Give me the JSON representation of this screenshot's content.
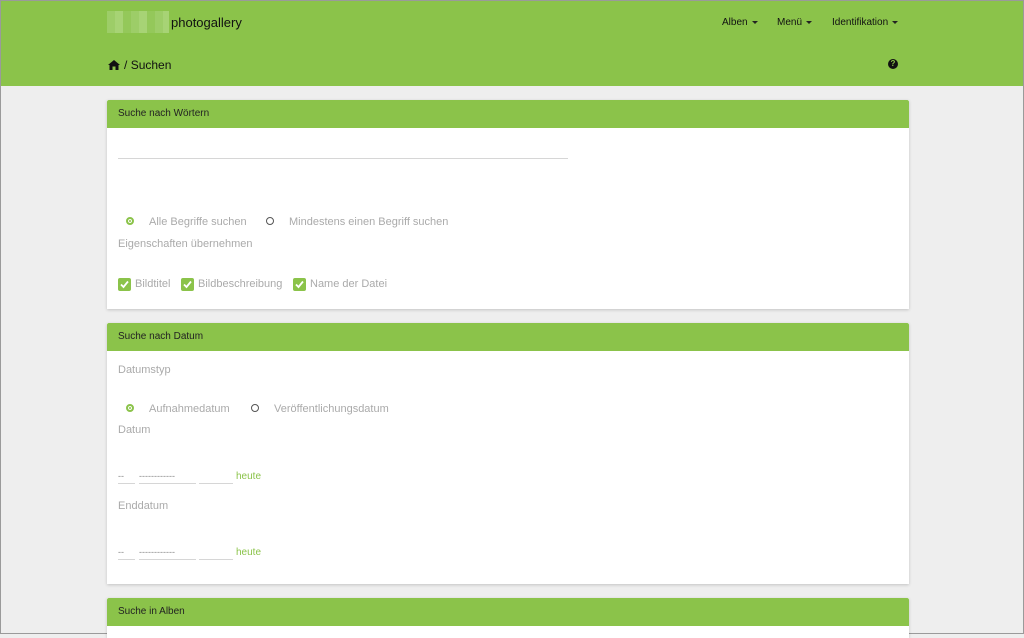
{
  "brand": "photogallery",
  "nav": {
    "albums": "Alben",
    "menu": "Menü",
    "identification": "Identifikation"
  },
  "breadcrumb": {
    "separator": "/",
    "title": "Suchen"
  },
  "search_words": {
    "header": "Suche nach Wörtern",
    "input_value": "",
    "mode_options": [
      "Alle Begriffe suchen",
      "Mindestens einen Begriff suchen"
    ],
    "mode_selected": "Alle Begriffe suchen",
    "properties_label": "Eigenschaften übernehmen",
    "properties": [
      "Bildtitel",
      "Bildbeschreibung",
      "Name der Datei"
    ]
  },
  "search_date": {
    "header": "Suche nach Datum",
    "type_label": "Datumstyp",
    "type_options": [
      "Aufnahmedatum",
      "Veröffentlichungsdatum"
    ],
    "type_selected": "Aufnahmedatum",
    "date_label": "Datum",
    "end_date_label": "Enddatum",
    "day_placeholder": "--",
    "month_placeholder": "------------",
    "year_value": "",
    "today_link": "heute"
  },
  "search_albums": {
    "header": "Suche in Alben"
  },
  "colors": {
    "accent": "#8bc34a",
    "background": "#eeeeee"
  }
}
